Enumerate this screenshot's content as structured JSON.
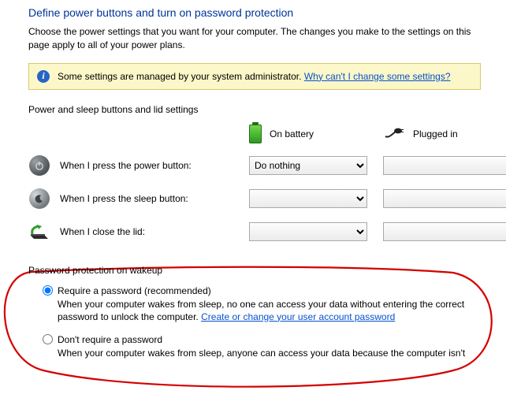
{
  "title": "Define power buttons and turn on password protection",
  "subtitle": "Choose the power settings that you want for your computer. The changes you make to the settings on this page apply to all of your power plans.",
  "warn": {
    "text": "Some settings are managed by your system administrator. ",
    "link": "Why can't I change some settings?"
  },
  "buttons_section": {
    "heading": "Power and sleep buttons and lid settings",
    "col_battery": "On battery",
    "col_plugged": "Plugged in",
    "rows": {
      "power": {
        "label": "When I press the power button:",
        "battery": "Do nothing",
        "plugged": ""
      },
      "sleep": {
        "label": "When I press the sleep button:",
        "battery": "",
        "plugged": ""
      },
      "lid": {
        "label": "When I close the lid:",
        "battery": "",
        "plugged": ""
      }
    }
  },
  "pwd_section": {
    "heading": "Password protection on wakeup",
    "require": {
      "label": "Require a password (recommended)",
      "desc_pre": "When your computer wakes from sleep, no one can access your data without entering the correct password to unlock the computer. ",
      "link": "Create or change your user account password"
    },
    "norequire": {
      "label": "Don't require a password",
      "desc": "When your computer wakes from sleep, anyone can access your data because the computer isn't"
    }
  }
}
